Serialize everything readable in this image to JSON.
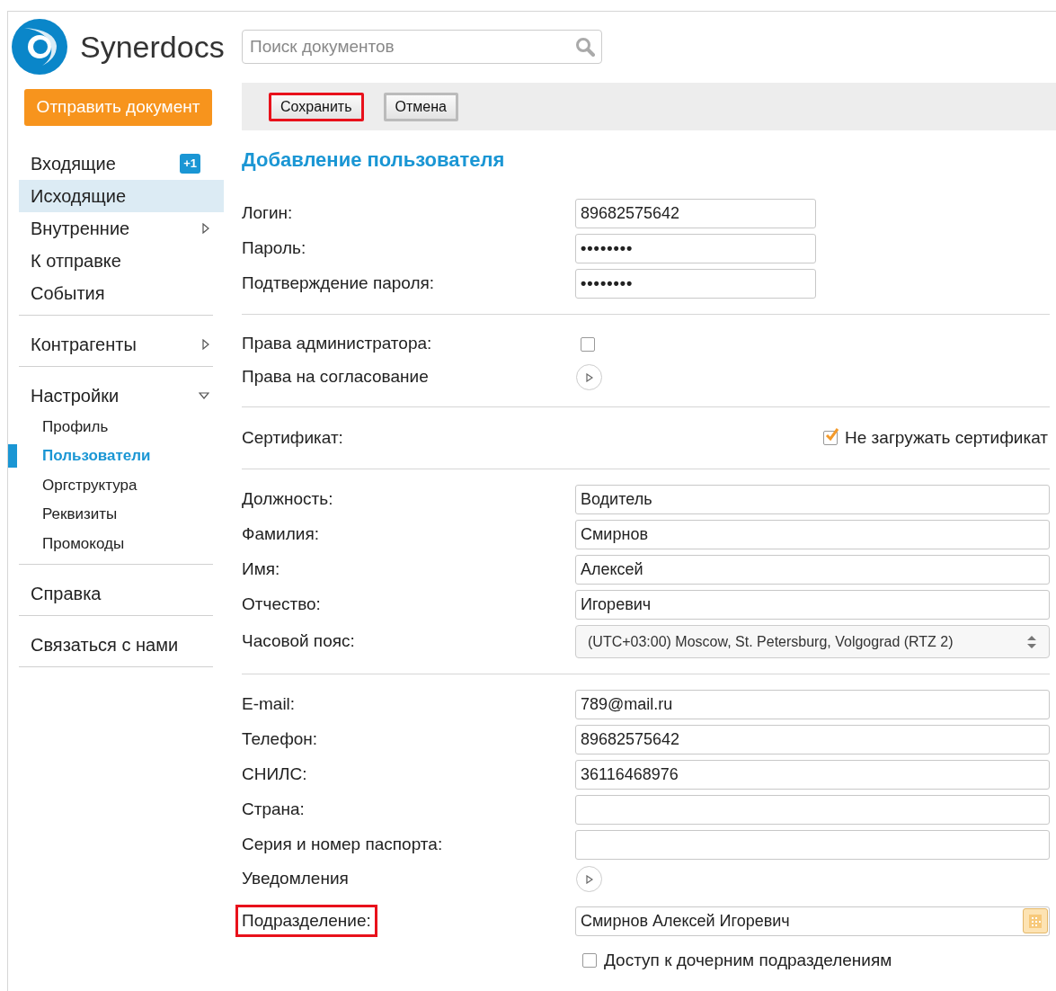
{
  "logo": {
    "text": "Synerdocs"
  },
  "search": {
    "placeholder": "Поиск документов"
  },
  "send_button": "Отправить документ",
  "sidebar": {
    "groups": [
      {
        "items": [
          {
            "label": "Входящие",
            "selected": false,
            "badge": "+1"
          },
          {
            "label": "Исходящие",
            "selected": true
          },
          {
            "label": "Внутренние",
            "selected": false,
            "expanded": false
          },
          {
            "label": "К отправке",
            "selected": false
          },
          {
            "label": "События",
            "selected": false
          }
        ]
      },
      {
        "items": [
          {
            "label": "Контрагенты",
            "selected": false,
            "expanded": false
          }
        ]
      },
      {
        "items": [
          {
            "label": "Настройки",
            "selected": false,
            "expanded": true,
            "children": [
              {
                "label": "Профиль",
                "selected": false
              },
              {
                "label": "Пользователи",
                "selected": true
              },
              {
                "label": "Оргструктура",
                "selected": false
              },
              {
                "label": "Реквизиты",
                "selected": false
              },
              {
                "label": "Промокоды",
                "selected": false
              }
            ]
          }
        ]
      },
      {
        "items": [
          {
            "label": "Справка",
            "selected": false
          }
        ]
      },
      {
        "items": [
          {
            "label": "Связаться с нами",
            "selected": false
          }
        ]
      }
    ]
  },
  "toolbar": {
    "buttons": [
      {
        "label": "Сохранить",
        "highlighted": true
      },
      {
        "label": "Отмена",
        "highlighted": false
      }
    ]
  },
  "form": {
    "title": "Добавление пользователя",
    "sections": [
      {
        "rows": [
          {
            "kind": "short_text",
            "label": "Логин:",
            "value": "89682575642"
          },
          {
            "kind": "password",
            "label": "Пароль:",
            "value": "••••••••"
          },
          {
            "kind": "password",
            "label": "Подтверждение пароля:",
            "value": "••••••••"
          }
        ]
      },
      {
        "rows": [
          {
            "kind": "checkbox",
            "label": "Права администратора:",
            "checked": false
          },
          {
            "kind": "expander",
            "label": "Права на согласование",
            "expanded": false
          }
        ]
      },
      {
        "rows": [
          {
            "kind": "cert",
            "label": "Сертификат:",
            "option": "Не загружать сертификат",
            "checked": true
          }
        ]
      },
      {
        "rows": [
          {
            "kind": "text",
            "label": "Должность:",
            "value": "Водитель"
          },
          {
            "kind": "text",
            "label": "Фамилия:",
            "value": "Смирнов"
          },
          {
            "kind": "text",
            "label": "Имя:",
            "value": "Алексей"
          },
          {
            "kind": "text",
            "label": "Отчество:",
            "value": "Игоревич"
          },
          {
            "kind": "select",
            "label": "Часовой пояс:",
            "value": "(UTC+03:00) Moscow, St. Petersburg, Volgograd (RTZ 2)"
          }
        ]
      },
      {
        "rows": [
          {
            "kind": "text",
            "label": "E-mail:",
            "value": "789@mail.ru"
          },
          {
            "kind": "text",
            "label": "Телефон:",
            "value": "89682575642"
          },
          {
            "kind": "text",
            "label": "СНИЛС:",
            "value": "36116468976"
          },
          {
            "kind": "text",
            "label": "Страна:"
          },
          {
            "kind": "text",
            "label": "Серия и номер паспорта:"
          },
          {
            "kind": "expander",
            "label": "Уведомления",
            "expanded": false
          },
          {
            "kind": "lookup",
            "label": "Подразделение:",
            "value": "Смирнов Алексей Игоревич",
            "highlighted": true,
            "option": "Доступ к дочерним подразделениям",
            "checked": false
          }
        ]
      }
    ]
  }
}
